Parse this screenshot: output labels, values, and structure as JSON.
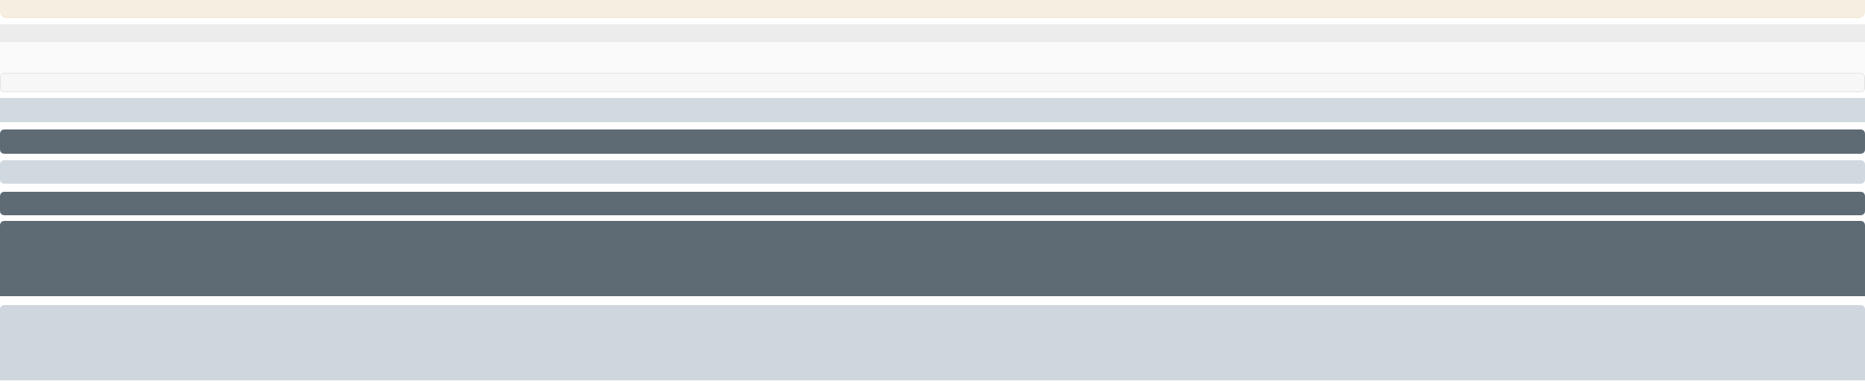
{
  "banner": {
    "text": ""
  },
  "header": {
    "text": ""
  },
  "panel": {
    "text": ""
  },
  "bars": [
    {
      "text": ""
    },
    {
      "text": ""
    },
    {
      "text": ""
    },
    {
      "text": ""
    },
    {
      "text": ""
    }
  ],
  "blocks": [
    {
      "text": ""
    },
    {
      "text": ""
    }
  ],
  "colors": {
    "banner": "#f6efe1",
    "strip": "#ececec",
    "panel": "#fafafa",
    "light_bar": "#d1dadf",
    "dark_bar": "#5e6b75",
    "light_block": "#cfd6de"
  }
}
